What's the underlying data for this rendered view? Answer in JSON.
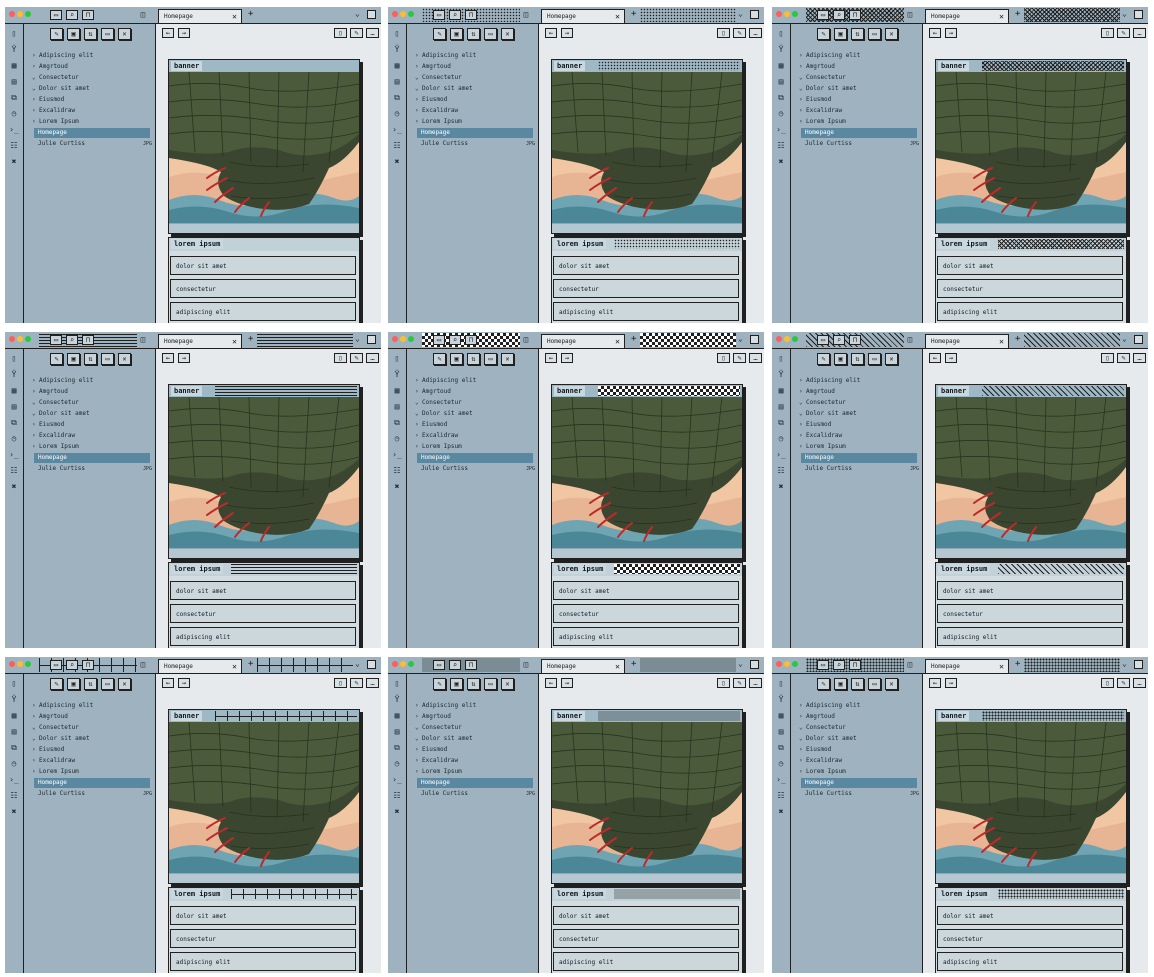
{
  "cells": [
    {
      "pattern": "none"
    },
    {
      "pattern": "dots"
    },
    {
      "pattern": "cross"
    },
    {
      "pattern": "lines"
    },
    {
      "pattern": "checker"
    },
    {
      "pattern": "diagonal"
    },
    {
      "pattern": "grid"
    },
    {
      "pattern": "finedots"
    },
    {
      "pattern": "dense"
    }
  ],
  "app": {
    "tab_title": "Homepage",
    "tab_close": "✕",
    "tab_add": "+",
    "tab_menu": "⌄",
    "nav_back": "←",
    "nav_forward": "→",
    "colors": {
      "sidebar": "#9eb3bf",
      "main": "#e6eaec",
      "accent": "#5b88a1",
      "border": "#202020"
    }
  },
  "explorer": {
    "items": [
      {
        "label": "Adipiscing elit",
        "chevron": "›"
      },
      {
        "label": "Amgrtoud",
        "chevron": "›"
      },
      {
        "label": "Consectetur",
        "chevron": "⌄"
      },
      {
        "label": "Dolor sit amet",
        "chevron": "⌄"
      },
      {
        "label": "Eiusmod",
        "chevron": "›"
      },
      {
        "label": "Excalidraw",
        "chevron": "›"
      },
      {
        "label": "Lorem Ipsum",
        "chevron": "›"
      },
      {
        "label": "Homepage",
        "chevron": "",
        "active": true
      }
    ],
    "file": {
      "label": "Julie Curtiss",
      "tag": "JPG"
    }
  },
  "content": {
    "banner_label": "banner",
    "list_label": "lorem ipsum",
    "rows": [
      "dolor sit amet",
      "consectetur",
      "adipiscing elit"
    ]
  }
}
